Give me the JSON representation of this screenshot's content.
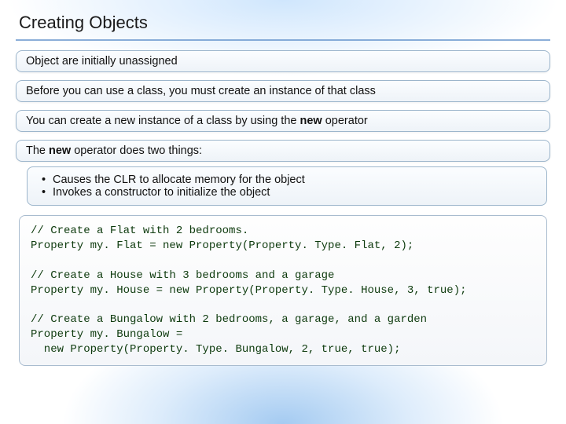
{
  "title": "Creating Objects",
  "boxes": [
    "Object are initially unassigned",
    "Before you can use a class, you must create an instance of that class"
  ],
  "box_new": {
    "pre": "You can create a new instance of a class by using the ",
    "bold": "new",
    "post": " operator"
  },
  "box_two": {
    "pre": "The ",
    "bold": "new",
    "post": " operator does two things:"
  },
  "bullets": [
    "Causes the CLR to allocate memory for the object",
    "Invokes a constructor to initialize the object"
  ],
  "code": "// Create a Flat with 2 bedrooms.\nProperty my. Flat = new Property(Property. Type. Flat, 2);\n\n// Create a House with 3 bedrooms and a garage\nProperty my. House = new Property(Property. Type. House, 3, true);\n\n// Create a Bungalow with 2 bedrooms, a garage, and a garden\nProperty my. Bungalow =\n  new Property(Property. Type. Bungalow, 2, true, true);"
}
